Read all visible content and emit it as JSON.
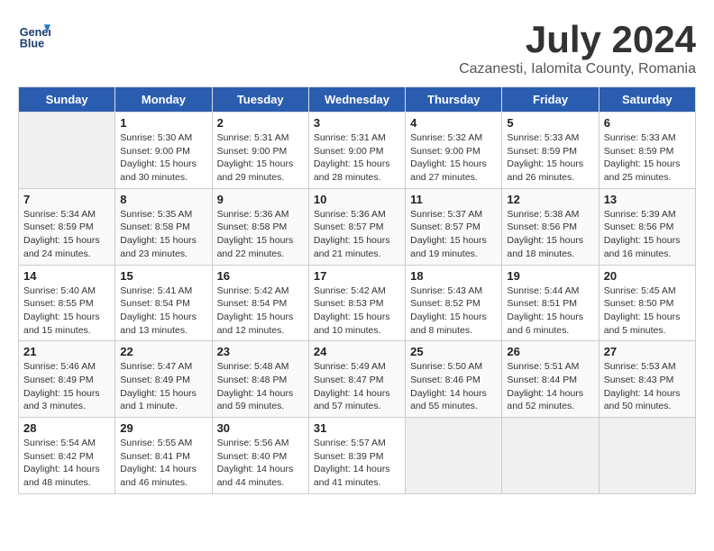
{
  "header": {
    "logo_line1": "General",
    "logo_line2": "Blue",
    "month_year": "July 2024",
    "location": "Cazanesti, Ialomita County, Romania"
  },
  "days_of_week": [
    "Sunday",
    "Monday",
    "Tuesday",
    "Wednesday",
    "Thursday",
    "Friday",
    "Saturday"
  ],
  "weeks": [
    [
      {
        "num": "",
        "empty": true
      },
      {
        "num": "1",
        "sunrise": "5:30 AM",
        "sunset": "9:00 PM",
        "daylight": "15 hours and 30 minutes."
      },
      {
        "num": "2",
        "sunrise": "5:31 AM",
        "sunset": "9:00 PM",
        "daylight": "15 hours and 29 minutes."
      },
      {
        "num": "3",
        "sunrise": "5:31 AM",
        "sunset": "9:00 PM",
        "daylight": "15 hours and 28 minutes."
      },
      {
        "num": "4",
        "sunrise": "5:32 AM",
        "sunset": "9:00 PM",
        "daylight": "15 hours and 27 minutes."
      },
      {
        "num": "5",
        "sunrise": "5:33 AM",
        "sunset": "8:59 PM",
        "daylight": "15 hours and 26 minutes."
      },
      {
        "num": "6",
        "sunrise": "5:33 AM",
        "sunset": "8:59 PM",
        "daylight": "15 hours and 25 minutes."
      }
    ],
    [
      {
        "num": "7",
        "sunrise": "5:34 AM",
        "sunset": "8:59 PM",
        "daylight": "15 hours and 24 minutes."
      },
      {
        "num": "8",
        "sunrise": "5:35 AM",
        "sunset": "8:58 PM",
        "daylight": "15 hours and 23 minutes."
      },
      {
        "num": "9",
        "sunrise": "5:36 AM",
        "sunset": "8:58 PM",
        "daylight": "15 hours and 22 minutes."
      },
      {
        "num": "10",
        "sunrise": "5:36 AM",
        "sunset": "8:57 PM",
        "daylight": "15 hours and 21 minutes."
      },
      {
        "num": "11",
        "sunrise": "5:37 AM",
        "sunset": "8:57 PM",
        "daylight": "15 hours and 19 minutes."
      },
      {
        "num": "12",
        "sunrise": "5:38 AM",
        "sunset": "8:56 PM",
        "daylight": "15 hours and 18 minutes."
      },
      {
        "num": "13",
        "sunrise": "5:39 AM",
        "sunset": "8:56 PM",
        "daylight": "15 hours and 16 minutes."
      }
    ],
    [
      {
        "num": "14",
        "sunrise": "5:40 AM",
        "sunset": "8:55 PM",
        "daylight": "15 hours and 15 minutes."
      },
      {
        "num": "15",
        "sunrise": "5:41 AM",
        "sunset": "8:54 PM",
        "daylight": "15 hours and 13 minutes."
      },
      {
        "num": "16",
        "sunrise": "5:42 AM",
        "sunset": "8:54 PM",
        "daylight": "15 hours and 12 minutes."
      },
      {
        "num": "17",
        "sunrise": "5:42 AM",
        "sunset": "8:53 PM",
        "daylight": "15 hours and 10 minutes."
      },
      {
        "num": "18",
        "sunrise": "5:43 AM",
        "sunset": "8:52 PM",
        "daylight": "15 hours and 8 minutes."
      },
      {
        "num": "19",
        "sunrise": "5:44 AM",
        "sunset": "8:51 PM",
        "daylight": "15 hours and 6 minutes."
      },
      {
        "num": "20",
        "sunrise": "5:45 AM",
        "sunset": "8:50 PM",
        "daylight": "15 hours and 5 minutes."
      }
    ],
    [
      {
        "num": "21",
        "sunrise": "5:46 AM",
        "sunset": "8:49 PM",
        "daylight": "15 hours and 3 minutes."
      },
      {
        "num": "22",
        "sunrise": "5:47 AM",
        "sunset": "8:49 PM",
        "daylight": "15 hours and 1 minute."
      },
      {
        "num": "23",
        "sunrise": "5:48 AM",
        "sunset": "8:48 PM",
        "daylight": "14 hours and 59 minutes."
      },
      {
        "num": "24",
        "sunrise": "5:49 AM",
        "sunset": "8:47 PM",
        "daylight": "14 hours and 57 minutes."
      },
      {
        "num": "25",
        "sunrise": "5:50 AM",
        "sunset": "8:46 PM",
        "daylight": "14 hours and 55 minutes."
      },
      {
        "num": "26",
        "sunrise": "5:51 AM",
        "sunset": "8:44 PM",
        "daylight": "14 hours and 52 minutes."
      },
      {
        "num": "27",
        "sunrise": "5:53 AM",
        "sunset": "8:43 PM",
        "daylight": "14 hours and 50 minutes."
      }
    ],
    [
      {
        "num": "28",
        "sunrise": "5:54 AM",
        "sunset": "8:42 PM",
        "daylight": "14 hours and 48 minutes."
      },
      {
        "num": "29",
        "sunrise": "5:55 AM",
        "sunset": "8:41 PM",
        "daylight": "14 hours and 46 minutes."
      },
      {
        "num": "30",
        "sunrise": "5:56 AM",
        "sunset": "8:40 PM",
        "daylight": "14 hours and 44 minutes."
      },
      {
        "num": "31",
        "sunrise": "5:57 AM",
        "sunset": "8:39 PM",
        "daylight": "14 hours and 41 minutes."
      },
      {
        "num": "",
        "empty": true
      },
      {
        "num": "",
        "empty": true
      },
      {
        "num": "",
        "empty": true
      }
    ]
  ]
}
